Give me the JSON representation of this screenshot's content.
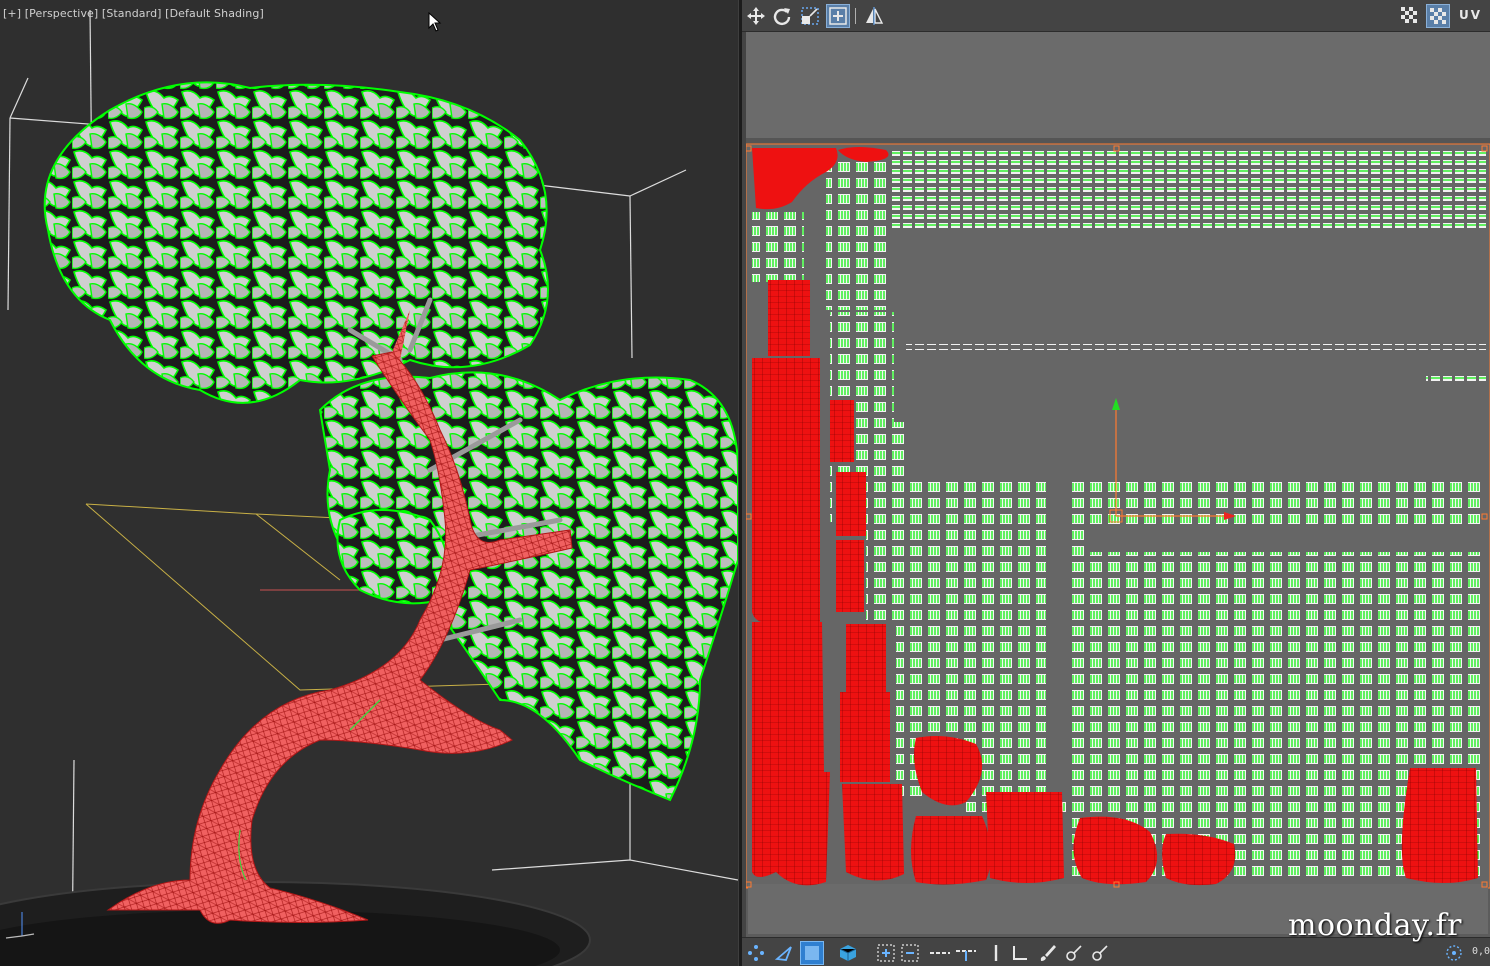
{
  "viewport": {
    "label_plus": "[+]",
    "label_view": "[Perspective]",
    "label_mode": "[Standard]",
    "label_shading": "[Default Shading]"
  },
  "colors": {
    "leaf_outline": "#00ff00",
    "leaf_fill": "#c8c8c8",
    "trunk": "#f06060",
    "trunk_wire": "#a01010",
    "uv_red": "#ee1111",
    "uv_green": "#00ee00",
    "uv_bg": "#5c5c5c",
    "uv_tile": "#6e6e6e",
    "gizmo_green": "#22dd22",
    "gizmo_red": "#ee2222",
    "gizmo_orange": "#ff7a30",
    "accent_blue": "#2f7fd0"
  },
  "uv_toolbar": {
    "icons": [
      "move-icon",
      "rotate-icon",
      "scale-icon",
      "freeform-icon",
      "mirror-icon"
    ],
    "right_icons": [
      "checker-icon",
      "checker-toggle-icon"
    ],
    "label": "UV"
  },
  "uv_bottombar": {
    "icons": [
      "point-to-point-icon",
      "triangle-select-icon",
      "square-select-icon",
      "element-icon",
      "grow-icon",
      "shrink-icon",
      "loop-icon",
      "ring-icon",
      "align-vertical-icon",
      "align-horizontal-icon",
      "brush-icon",
      "pin-icon",
      "unpin-icon",
      "soft-select-icon"
    ],
    "coord": "0,0"
  },
  "watermark": "moonday.fr"
}
